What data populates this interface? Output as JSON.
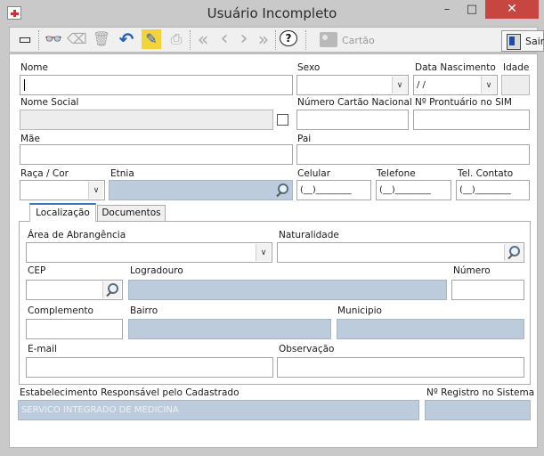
{
  "window": {
    "title": "Usuário Incompleto",
    "minimize_glyph": "–",
    "maximize_glyph": "□",
    "close_glyph": "✕"
  },
  "toolbar": {
    "items": [
      {
        "icon": "new-document-icon",
        "glyph": "▭",
        "enabled": true
      },
      {
        "icon": "binoculars-icon",
        "glyph": "👓",
        "enabled": false
      },
      {
        "icon": "eraser-icon",
        "glyph": "⌫",
        "enabled": false
      },
      {
        "icon": "trash-icon",
        "glyph": "🗑",
        "enabled": false
      },
      {
        "icon": "undo-icon",
        "glyph": "↶",
        "enabled": true
      },
      {
        "icon": "edit-icon",
        "glyph": "✎",
        "enabled": true
      },
      {
        "icon": "print-icon",
        "glyph": "⎙",
        "enabled": false
      },
      {
        "icon": "first-record-icon",
        "glyph": "«",
        "enabled": false
      },
      {
        "icon": "previous-record-icon",
        "glyph": "‹",
        "enabled": false
      },
      {
        "icon": "next-record-icon",
        "glyph": "›",
        "enabled": false
      },
      {
        "icon": "last-record-icon",
        "glyph": "»",
        "enabled": false
      },
      {
        "icon": "help-icon",
        "glyph": "?",
        "enabled": true
      }
    ],
    "card_label": "Cartão",
    "exit_label": "Sair"
  },
  "form": {
    "nome": {
      "label": "Nome",
      "value": ""
    },
    "sexo": {
      "label": "Sexo",
      "value": ""
    },
    "data_nascimento": {
      "label": "Data Nascimento",
      "value": " /  /"
    },
    "idade": {
      "label": "Idade",
      "value": ""
    },
    "nome_social": {
      "label": "Nome Social",
      "value": ""
    },
    "numero_cartao": {
      "label": "Número Cartão Nacional",
      "value": ""
    },
    "prontuario": {
      "label": "Nº Prontuário no SIM",
      "value": ""
    },
    "mae": {
      "label": "Mãe",
      "value": ""
    },
    "pai": {
      "label": "Pai",
      "value": ""
    },
    "raca_cor": {
      "label": "Raça / Cor",
      "value": ""
    },
    "etnia": {
      "label": "Etnia",
      "value": ""
    },
    "celular": {
      "label": "Celular",
      "value": "(__)________"
    },
    "telefone": {
      "label": "Telefone",
      "value": "(__)________"
    },
    "tel_contato": {
      "label": "Tel. Contato",
      "value": "(__)________"
    }
  },
  "tabs": [
    {
      "label": "Localização",
      "active": true
    },
    {
      "label": "Documentos",
      "active": false
    }
  ],
  "localizacao": {
    "area_abrangencia": {
      "label": "Área de Abrangência",
      "value": ""
    },
    "naturalidade": {
      "label": "Naturalidade",
      "value": ""
    },
    "cep": {
      "label": "CEP",
      "value": ""
    },
    "logradouro": {
      "label": "Logradouro",
      "value": ""
    },
    "numero": {
      "label": "Número",
      "value": ""
    },
    "complemento": {
      "label": "Complemento",
      "value": ""
    },
    "bairro": {
      "label": "Bairro",
      "value": ""
    },
    "municipio": {
      "label": "Municipio",
      "value": ""
    },
    "email": {
      "label": "E-mail",
      "value": ""
    },
    "observacao": {
      "label": "Observação",
      "value": ""
    }
  },
  "footer": {
    "estabelecimento": {
      "label": "Estabelecimento Responsável pelo Cadastrado",
      "value": "SERVICO INTEGRADO DE MEDICINA"
    },
    "registro": {
      "label": "Nº Registro no Sistema",
      "value": ""
    }
  }
}
